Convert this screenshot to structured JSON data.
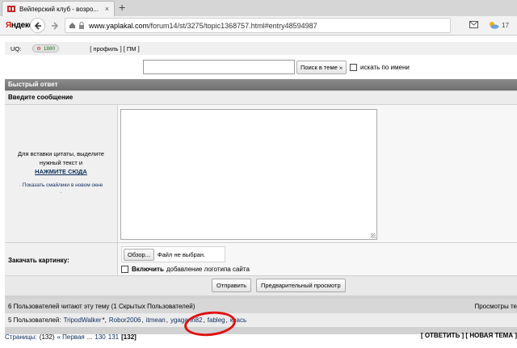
{
  "browser": {
    "tab_title": "Вейперский клуб - возро...",
    "new_tab": "+",
    "tab_close": "×",
    "yandex_logo_red": "Я",
    "yandex_logo_rest": "ндекс",
    "url_host": "www.yaplakal.com",
    "url_path": "/forum14/st/3275/topic1368757.html#entry48594987",
    "weather_temp": "17",
    "icons": [
      "yaplakal-favicon",
      "back-arrow-icon",
      "forward-arrow-icon",
      "home-icon",
      "lock-icon",
      "mail-icon",
      "weather-icon"
    ]
  },
  "user_bar": {
    "uq_label": "UQ:",
    "uq_minus": "⊖",
    "uq_value": "1880",
    "links_text": "[ профиль ] [ ПМ ]"
  },
  "search": {
    "button": "Поиск в теме »",
    "checkbox_label": "искать по имени"
  },
  "reply": {
    "header": "Быстрый ответ",
    "enter_message": "Введите сообщение",
    "quote_hint": "Для вставки цитаты, выделите нужный текст и",
    "quote_action": "НАЖМИТЕ СЮДА",
    "smiles_link": "· Показать смайлики в новом окне",
    "smiles_dot": "·",
    "message_value": "",
    "upload_label": "Закачать картинку:",
    "browse_button": "Обзор...",
    "file_status": "Файл не выбран.",
    "logo_bold": "Включить",
    "logo_rest": "добавление логотипа сайта",
    "send_button": "Отправить",
    "preview_button": "Предварительный просмотр"
  },
  "readers": {
    "text": "6 Пользователей читают эту тему (1 Скрытых Пользователей)",
    "views": "Просмотры те"
  },
  "users_online": {
    "prefix": "5 Пользователей:",
    "names": [
      "TripodWalker",
      "Robor2006",
      "itmean",
      "ygagarin82",
      "fableg",
      "квась"
    ],
    "suffixes": [
      "*,",
      ",",
      ",",
      ",",
      ",",
      ""
    ],
    "highlighted_user": "ygagarin82",
    "highlight_color": "#e01010"
  },
  "pager": {
    "label": "Страницы:",
    "total": "(132)",
    "first": "« Первая",
    "ellipsis": "...",
    "p130": "130",
    "p131": "131",
    "current": "[132]",
    "reply_links": "[ ОТВЕТИТЬ ] [ НОВАЯ ТЕМА ]"
  }
}
